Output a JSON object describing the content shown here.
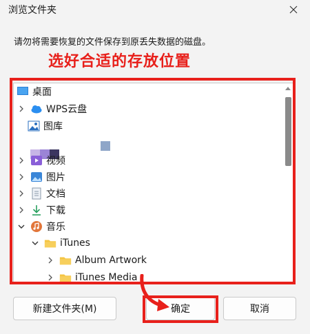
{
  "window": {
    "title": "浏览文件夹"
  },
  "instruction": "请勿将需要恢复的文件保存到原丢失数据的磁盘。",
  "annotation": "选好合适的存放位置",
  "tree": {
    "items": [
      {
        "label": "桌面",
        "icon": "desktop-icon"
      },
      {
        "label": "WPS云盘",
        "icon": "cloud-icon"
      },
      {
        "label": "图库",
        "icon": "gallery-icon"
      },
      {
        "label": "视频",
        "icon": "video-icon"
      },
      {
        "label": "图片",
        "icon": "picture-icon"
      },
      {
        "label": "文档",
        "icon": "document-icon"
      },
      {
        "label": "下载",
        "icon": "download-icon"
      },
      {
        "label": "音乐",
        "icon": "music-icon"
      },
      {
        "label": "iTunes",
        "icon": "folder-icon"
      },
      {
        "label": "Album Artwork",
        "icon": "folder-icon"
      },
      {
        "label": "iTunes Media",
        "icon": "folder-icon"
      }
    ]
  },
  "buttons": {
    "new_folder": "新建文件夹(M)",
    "ok": "确定",
    "cancel": "取消"
  },
  "colors": {
    "accent_red": "#e8201b",
    "folder": "#f5c542"
  }
}
